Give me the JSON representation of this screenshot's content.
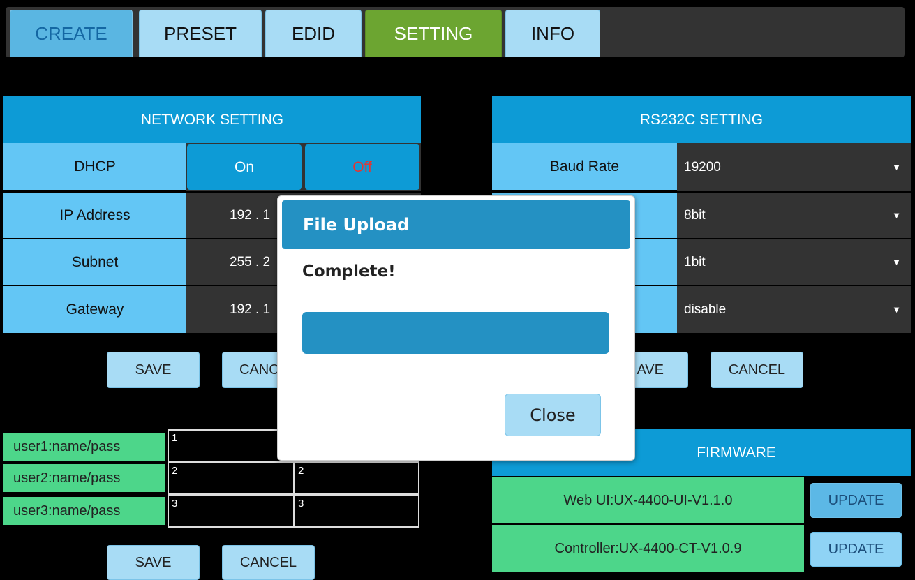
{
  "tabs": [
    {
      "label": "CREATE"
    },
    {
      "label": "PRESET"
    },
    {
      "label": "EDID"
    },
    {
      "label": "SETTING"
    },
    {
      "label": "INFO"
    }
  ],
  "network": {
    "title": "NETWORK SETTING",
    "dhcp_label": "DHCP",
    "on_label": "On",
    "off_label": "Off",
    "ip_label": "IP Address",
    "ip_value": "192 . 1",
    "subnet_label": "Subnet",
    "subnet_value": "255 . 2",
    "gateway_label": "Gateway",
    "gateway_value": "192 . 1",
    "save_label": "SAVE",
    "cancel_label": "CANC"
  },
  "users": {
    "rows": [
      {
        "label": "user1:name/pass",
        "name": "1",
        "pass": ""
      },
      {
        "label": "user2:name/pass",
        "name": "2",
        "pass": "2"
      },
      {
        "label": "user3:name/pass",
        "name": "3",
        "pass": "3"
      }
    ],
    "save_label": "SAVE",
    "cancel_label": "CANCEL"
  },
  "rs232": {
    "title": "RS232C SETTING",
    "baud_label": "Baud Rate",
    "baud_value": "19200",
    "data_bits_value": "8bit",
    "stop_bits_value": "1bit",
    "parity_value": "disable",
    "save_label": "AVE",
    "cancel_label": "CANCEL"
  },
  "firmware": {
    "title": "FIRMWARE",
    "web_ui": "Web UI:UX-4400-UI-V1.1.0",
    "controller": "Controller:UX-4400-CT-V1.0.9",
    "update_label": "UPDATE"
  },
  "modal": {
    "title": "File Upload",
    "message": "Complete!",
    "progress": 1.0,
    "close_label": "Close"
  },
  "colors": {
    "header_blue": "#0d9bd6",
    "label_blue": "#63c6f5",
    "setting_green": "#6ca531",
    "user_green": "#4dd68a",
    "off_red": "#e8332f"
  }
}
